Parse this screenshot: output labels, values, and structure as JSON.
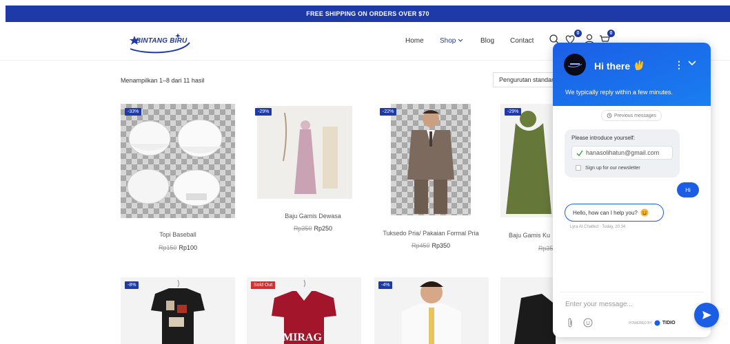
{
  "top_banner": {
    "text": "FREE SHIPPING ON ORDERS OVER $70"
  },
  "header": {
    "logo_text": "BINTANG BIRU",
    "nav": {
      "home": "Home",
      "shop": "Shop",
      "blog": "Blog",
      "contact": "Contact"
    },
    "wishlist_count": "0",
    "cart_count": "0"
  },
  "toolbar": {
    "results_text": "Menampilkan 1–8 dari 11 hasil",
    "sort_label": "Pengurutan standar"
  },
  "products": [
    {
      "name": "Topi Baseball",
      "old_price": "Rp150",
      "price": "Rp100",
      "badge": "-33%"
    },
    {
      "name": "Baju Gamis Dewasa",
      "old_price": "Rp350",
      "price": "Rp250",
      "badge": "-29%"
    },
    {
      "name": "Tuksedo Pria/ Pakaian Formal Pria",
      "old_price": "Rp450",
      "price": "Rp350",
      "badge": "-22%"
    },
    {
      "name": "Baju Gamis Ku",
      "old_price": "Rp35",
      "price": "",
      "badge": "-29%"
    },
    {
      "badge": "-8%"
    },
    {
      "badge": "Sold Out",
      "shirt_text": "MIRAG"
    },
    {
      "badge": "-4%"
    },
    {
      "badge": ""
    }
  ],
  "chat": {
    "title": "Hi there",
    "subtitle": "We typically reply within a few minutes.",
    "previous_messages": "Previous messages",
    "intro_label": "Please introduce yourself:",
    "email_value": "hanasolihatun@gmail.com",
    "newsletter_label": "Sign up for our newsletter",
    "user_message": "Hi",
    "bot_message": "Hello, how can I help you?",
    "bot_meta": "Lyra AI Chatbot · Today, 20:34",
    "input_placeholder": "Enter your message...",
    "powered_by": "POWERED BY",
    "brand": "TIDIO",
    "colors": {
      "primary": "#1b5ee6",
      "navy": "#1e3aa8"
    }
  }
}
